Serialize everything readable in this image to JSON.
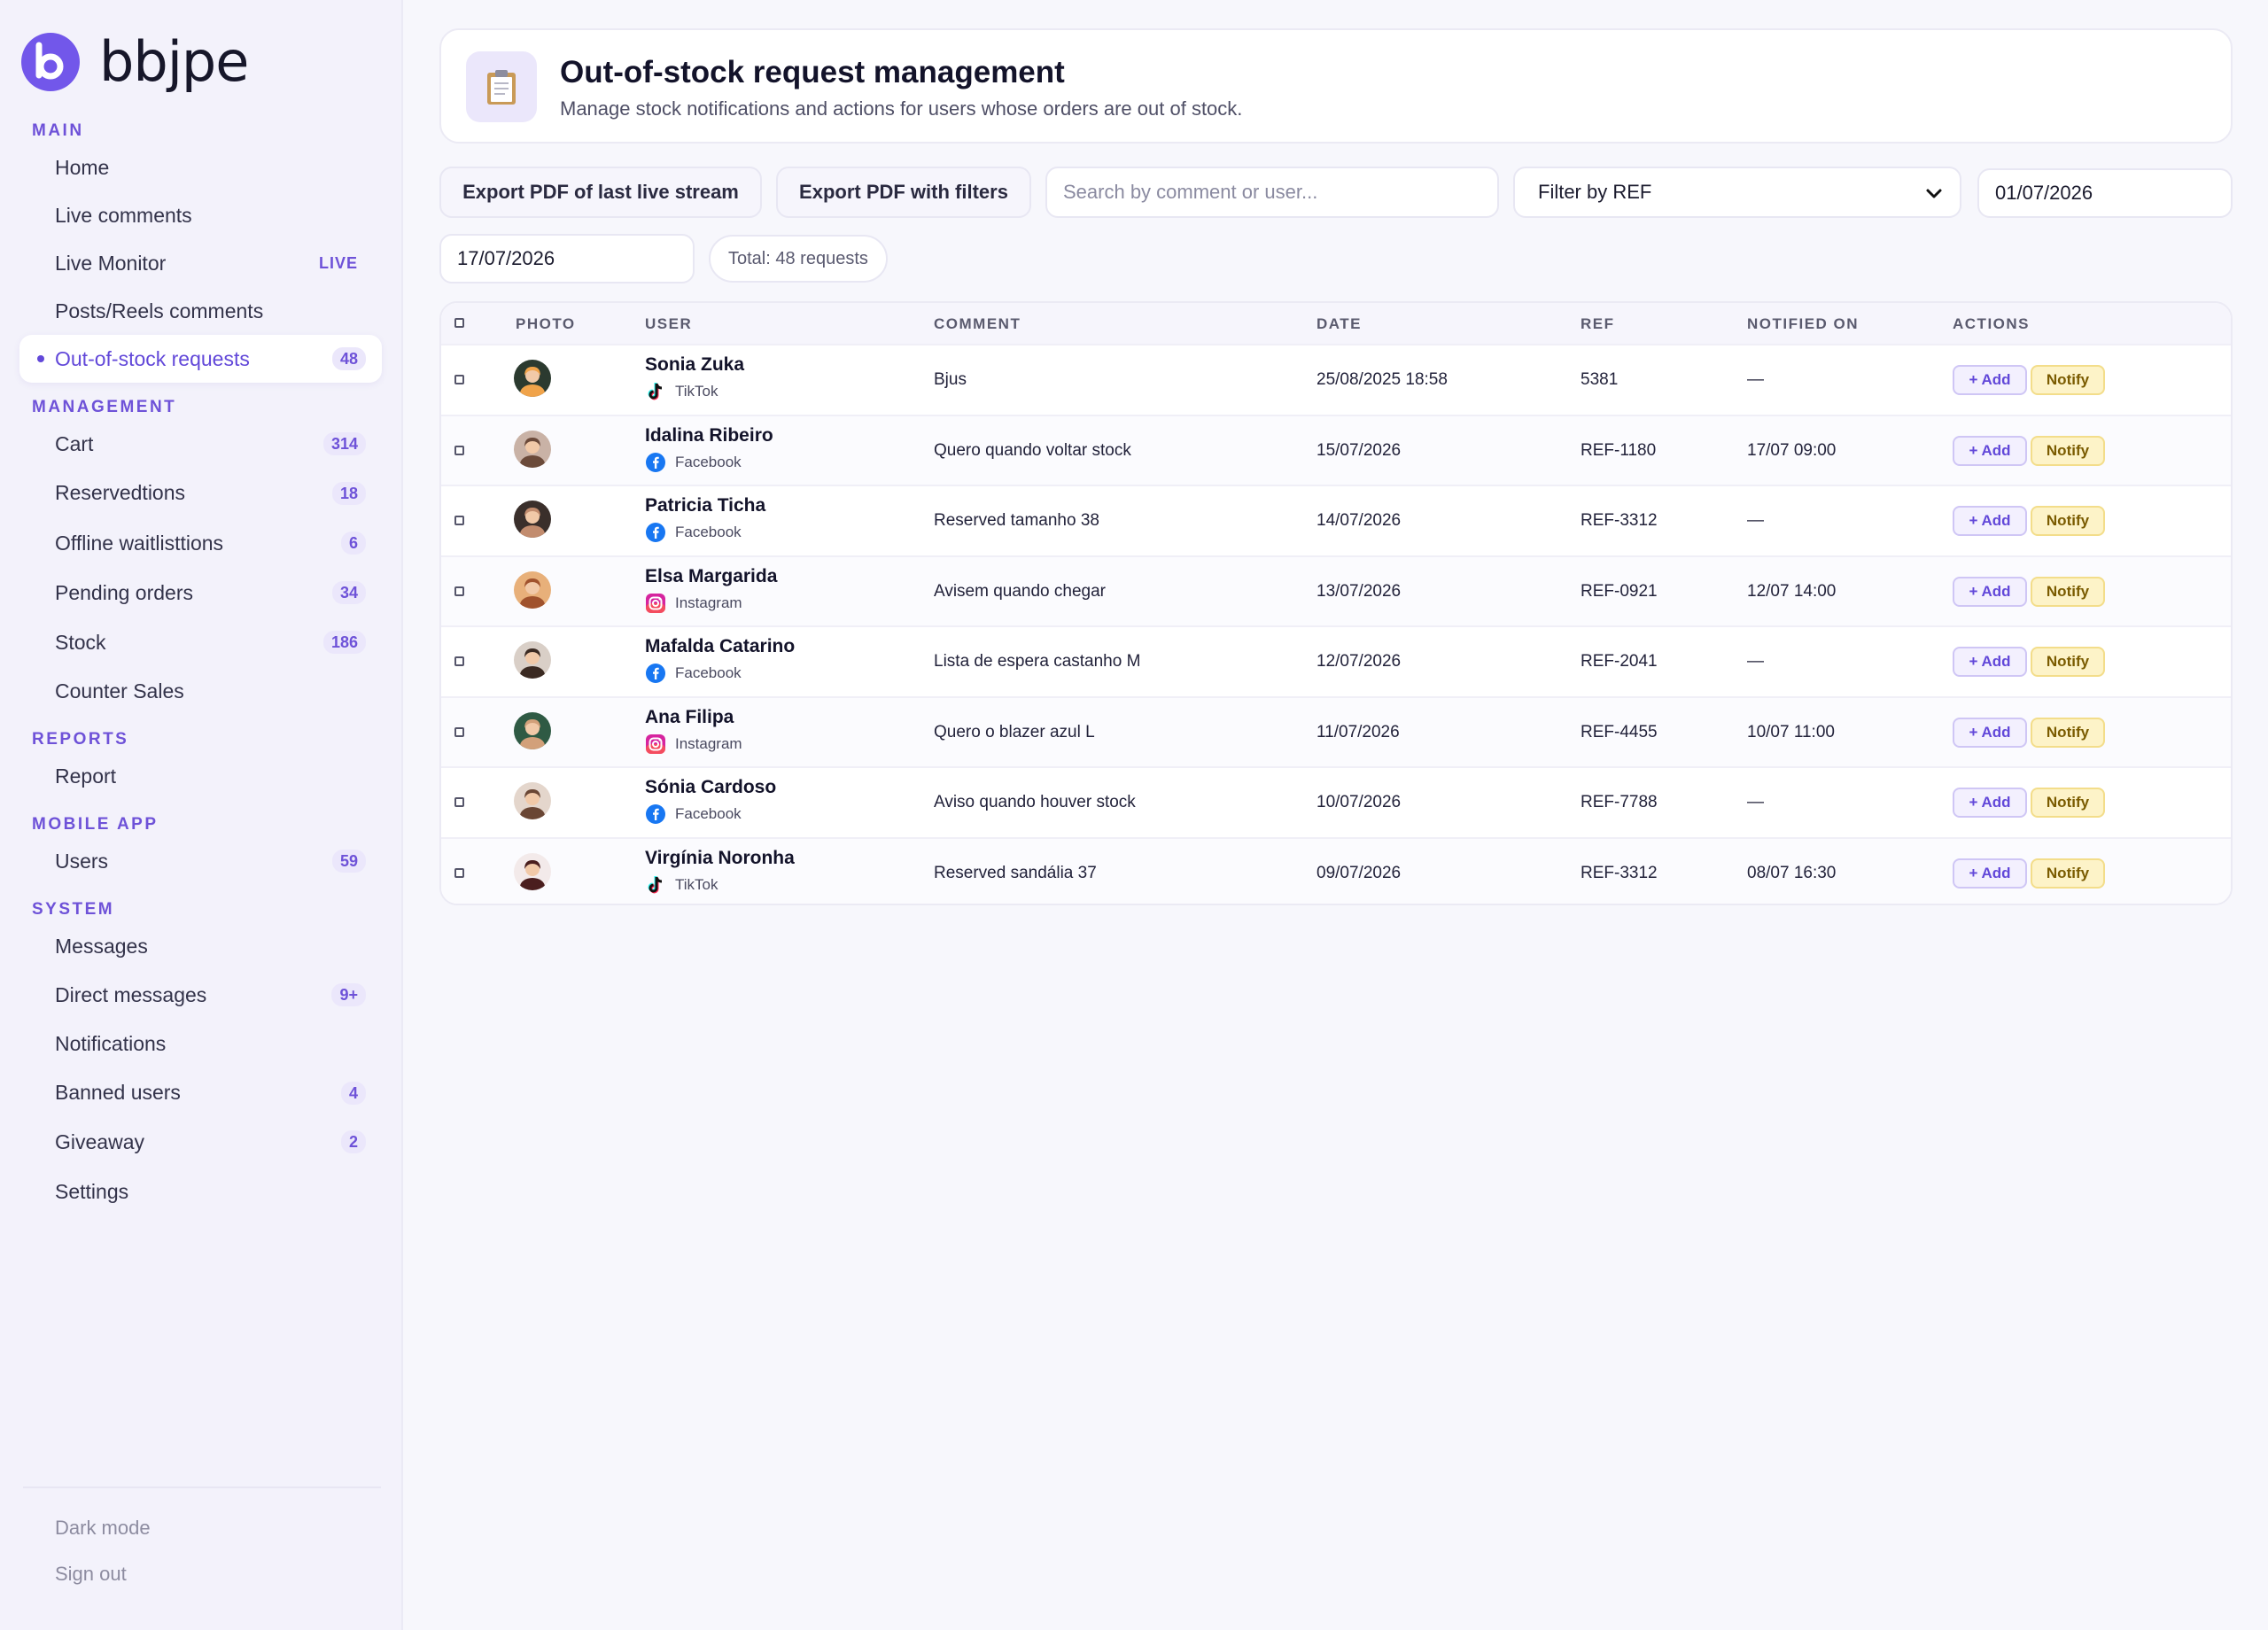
{
  "brand": {
    "name": "bbjpe",
    "accent": "#6e52d8"
  },
  "sidebar": {
    "sections": [
      {
        "title": "MAIN",
        "items": [
          {
            "label": "Home"
          },
          {
            "label": "Live comments"
          },
          {
            "label": "Live Monitor",
            "badge": "LIVE"
          },
          {
            "label": "Posts/Reels comments"
          },
          {
            "label": "Out-of-stock requests",
            "badge": "48",
            "active": true
          }
        ]
      },
      {
        "title": "MANAGEMENT",
        "items": [
          {
            "label": "Cart",
            "badge": "314"
          },
          {
            "label": "Reservedtions",
            "badge": "18"
          },
          {
            "label": "Offline waitlisttions",
            "badge": "6"
          },
          {
            "label": "Pending orders",
            "badge": "34"
          },
          {
            "label": "Stock",
            "badge": "186"
          },
          {
            "label": "Counter Sales"
          }
        ]
      },
      {
        "title": "REPORTS",
        "items": [
          {
            "label": "Report"
          }
        ]
      },
      {
        "title": "MOBILE APP",
        "items": [
          {
            "label": "Users",
            "badge": "59"
          }
        ]
      },
      {
        "title": "SYSTEM",
        "items": [
          {
            "label": "Messages"
          },
          {
            "label": "Direct messages",
            "badge": "9+"
          },
          {
            "label": "Notifications"
          },
          {
            "label": "Banned users",
            "badge": "4"
          },
          {
            "label": "Giveaway",
            "badge": "2"
          },
          {
            "label": "Settings"
          }
        ]
      }
    ],
    "footer": {
      "dark_mode": "Dark mode",
      "sign_out": "Sign out"
    }
  },
  "header": {
    "icon": "clipboard-icon",
    "title": "Out-of-stock request management",
    "subtitle": "Manage stock notifications and actions for users whose orders are out of stock."
  },
  "toolbar": {
    "export_last_live": "Export PDF of last live stream",
    "export_filters": "Export PDF with filters",
    "search_placeholder": "Search by comment or user...",
    "ref_filter": "Filter by REF",
    "date_from": "01/07/2026",
    "date_to": "17/07/2026",
    "total": "Total: 48 requests"
  },
  "table": {
    "columns": [
      "PHOTO",
      "USER",
      "COMMENT",
      "DATE",
      "REF",
      "NOTIFIED ON",
      "ACTIONS"
    ],
    "add_label": "+ Add",
    "notify_label": "Notify",
    "rows": [
      {
        "user": "Sonia Zuka",
        "platform": "TikTok",
        "comment": "Bjus",
        "date": "25/08/2025 18:58",
        "ref": "5381",
        "notified": "—"
      },
      {
        "user": "Idalina Ribeiro",
        "platform": "Facebook",
        "comment": "Quero quando voltar stock",
        "date": "15/07/2026",
        "ref": "REF-1180",
        "notified": "17/07 09:00"
      },
      {
        "user": "Patricia Ticha",
        "platform": "Facebook",
        "comment": "Reserved tamanho 38",
        "date": "14/07/2026",
        "ref": "REF-3312",
        "notified": "—"
      },
      {
        "user": "Elsa Margarida",
        "platform": "Instagram",
        "comment": "Avisem quando chegar",
        "date": "13/07/2026",
        "ref": "REF-0921",
        "notified": "12/07 14:00"
      },
      {
        "user": "Mafalda Catarino",
        "platform": "Facebook",
        "comment": "Lista de espera castanho M",
        "date": "12/07/2026",
        "ref": "REF-2041",
        "notified": "—"
      },
      {
        "user": "Ana Filipa",
        "platform": "Instagram",
        "comment": "Quero o blazer azul L",
        "date": "11/07/2026",
        "ref": "REF-4455",
        "notified": "10/07 11:00"
      },
      {
        "user": "Sónia Cardoso",
        "platform": "Facebook",
        "comment": "Aviso quando houver stock",
        "date": "10/07/2026",
        "ref": "REF-7788",
        "notified": "—"
      },
      {
        "user": "Virgínia Noronha",
        "platform": "TikTok",
        "comment": "Reserved sandália 37",
        "date": "09/07/2026",
        "ref": "REF-3312",
        "notified": "08/07 16:30"
      }
    ]
  }
}
